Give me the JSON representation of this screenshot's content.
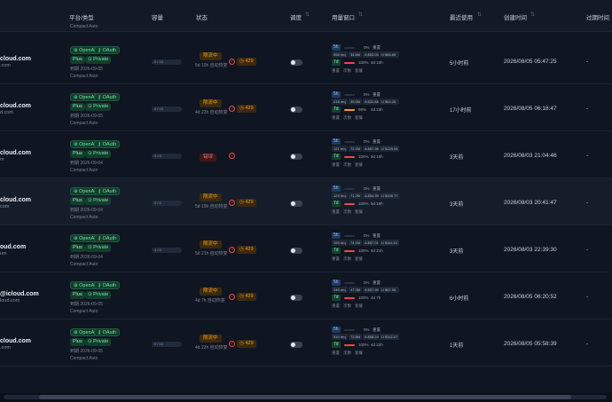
{
  "columns": {
    "platform": "平台/类型",
    "capacity": "容量",
    "status": "状态",
    "sched": "调度",
    "usage": "用量窗口",
    "last_used": "最近使用",
    "created": "创建时间",
    "expire": "过期时间"
  },
  "top_partial": "Compact Auto",
  "rows": [
    {
      "name": "cloud.com",
      "sub": ".com",
      "plan": "Plus",
      "date": "到期 2026-09-05",
      "mode": "Compact Auto",
      "cap": "0 / 10",
      "status": "限流中",
      "status_kind": "limit",
      "status_sub": "5d 10h 自动恢复",
      "has429": true,
      "r": "596 req",
      "tok": "34.8M",
      "a": "A $53.03",
      "u": "U $86.65",
      "pct5": "0%",
      "pct7": "100%",
      "res7": "5d 10h",
      "bar7": 1.0,
      "bar7c": "#ef4444",
      "last": "5小时前",
      "created": "2026/08/05 05:47:25",
      "exp": "-"
    },
    {
      "name": "cloud.com",
      "sub": "d.com",
      "plan": "Plus",
      "date": "到期 2026-09-05",
      "mode": "Compact Auto",
      "cap": "0 / 10",
      "status": "限流中",
      "status_kind": "limit",
      "status_sub": "4d 23h 自动恢复",
      "has429": true,
      "r": "218 req",
      "tok": "35.5M",
      "a": "A $32.86",
      "u": "U $64.26",
      "pct5": "0%",
      "pct7": "96%",
      "res7": "4d 23h",
      "bar7": 0.96,
      "bar7c": "#f59e0b",
      "last": "17小时前",
      "created": "2026/08/05 06:18:47",
      "exp": "-"
    },
    {
      "name": "cloud.com",
      "sub": "m",
      "plan": "Plus",
      "date": "到期 2026-09-04",
      "mode": "Compact Auto",
      "cap": "0 / 6",
      "status": "错误",
      "status_kind": "err",
      "status_sub": "",
      "has429": false,
      "r": "121 req",
      "tok": "72.1M",
      "a": "A $67.96",
      "u": "U $129.04",
      "pct5": "0%",
      "pct7": "100%",
      "res7": "5d 18h",
      "bar7": 1.0,
      "bar7c": "#ef4444",
      "last": "3天前",
      "created": "2026/08/03 21:04:46",
      "exp": "-"
    },
    {
      "name": "cloud.com",
      "sub": "com",
      "plan": "Plus",
      "date": "到期 2026-09-04",
      "mode": "Compact Auto",
      "cap": "0 / 6",
      "status": "限流中",
      "status_kind": "limit",
      "status_sub": "5d 19h 自动恢复",
      "has429": true,
      "r": "129 req",
      "tok": "71.2M",
      "a": "A $54.39",
      "u": "U $108.77",
      "pct5": "0%",
      "pct7": "100%",
      "res7": "5d 19h",
      "bar7": 1.0,
      "bar7c": "#ef4444",
      "last": "3天前",
      "created": "2026/08/03 20:41:47",
      "exp": "-"
    },
    {
      "name": "oud.com",
      "sub": "om",
      "plan": "Plus",
      "date": "到期 2026-09-04",
      "mode": "Compact Auto",
      "cap": "0 / 6",
      "status": "限流中",
      "status_kind": "limit",
      "status_sub": "5d 21h 自动恢复",
      "has429": true,
      "r": "159 req",
      "tok": "74.1M",
      "a": "A $57.01",
      "u": "U $114.01",
      "pct5": "0%",
      "pct7": "100%",
      "res7": "5d 21h",
      "bar7": 1.0,
      "bar7c": "#ef4444",
      "last": "3天前",
      "created": "2026/08/03 22:39:30",
      "exp": "-"
    },
    {
      "name": "@icloud.com",
      "sub": "loud.com",
      "plan": "Plus",
      "date": "到期 2026-09-05",
      "mode": "Compact Auto",
      "cap": "",
      "status": "限流中",
      "status_kind": "limit",
      "status_sub": "4d 7h 自动恢复",
      "has429": true,
      "r": "349 req",
      "tok": "47.3M",
      "a": "A $37.90",
      "u": "U $57.55",
      "pct5": "0%",
      "pct7": "100%",
      "res7": "4d 7h",
      "bar7": 1.0,
      "bar7c": "#ef4444",
      "last": "6小时前",
      "created": "2026/08/05 06:20:52",
      "exp": "-"
    },
    {
      "name": "cloud.com",
      "sub": ".com",
      "plan": "Plus",
      "date": "到期 2026-09-05",
      "mode": "Compact Auto",
      "cap": "0 / 10",
      "status": "限流中",
      "status_kind": "limit",
      "status_sub": "4d 22h 自动恢复",
      "has429": true,
      "r": "510 req",
      "tok": "72.8M",
      "a": "A $58.24",
      "u": "U $112.07",
      "pct5": "0%",
      "pct7": "100%",
      "res7": "4d 22h",
      "bar7": 1.0,
      "bar7c": "#ef4444",
      "last": "1天前",
      "created": "2026/08/05 05:58:39",
      "exp": "-"
    }
  ],
  "labels": {
    "openai": "OpenAI",
    "oauth": "OAuth",
    "private": "Private",
    "t5": "5h",
    "t7": "7d",
    "reset": "重置",
    "calc": "次数",
    "guard": "套餐",
    "badge429": "429"
  }
}
